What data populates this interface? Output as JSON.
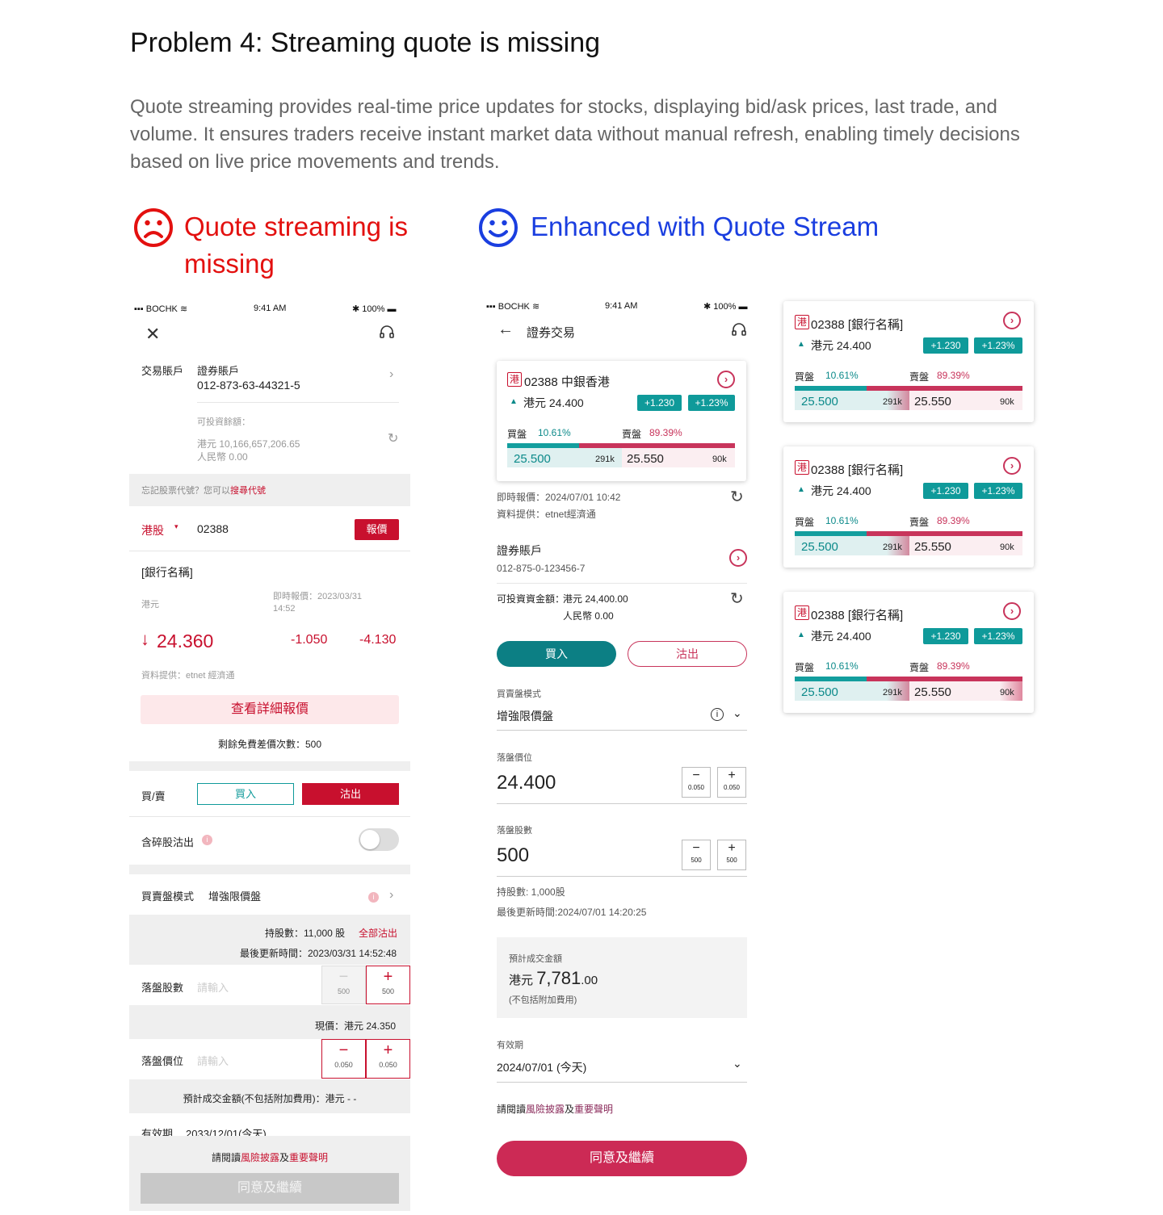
{
  "title": "Problem 4: Streaming quote is missing",
  "description": "Quote streaming provides real-time price updates for stocks, displaying bid/ask prices, last trade, and volume. It ensures traders receive instant market data without manual refresh, enabling timely decisions based on live price movements and trends.",
  "colors": {
    "bad": "#e3100f",
    "good": "#1a3ee0",
    "teal": "#0f9a9a",
    "brand_red": "#c8102e"
  },
  "bad": {
    "heading": "Quote streaming is missing",
    "status": {
      "carrier": "BOCHK",
      "time": "9:41 AM",
      "battery": "100%"
    },
    "account_label": "交易賬戶",
    "account_type": "證券賬戶",
    "account_no": "012-873-63-44321-5",
    "funds_label": "可投資餘額：",
    "funds_hkd": "港元 10,166,657,206.65",
    "funds_rmb": "人民幣 0.00",
    "forgot_text": "忘記股票代號？您可以",
    "forgot_link": "搜尋代號",
    "market": "港股",
    "code": "02388",
    "quote_btn": "報價",
    "name": "[銀行名稱]",
    "currency": "港元",
    "quote_time": "即時報價：2023/03/31 14:52",
    "price": "24.360",
    "change": "-1.050",
    "change_pct": "-4.130",
    "source": "資料提供：etnet 經濟通",
    "detail_btn": "查看詳細報價",
    "remain": "剩餘免費差價次數：500",
    "side_label": "買/賣",
    "buy": "買入",
    "sell": "沽出",
    "odd_lot": "含碎股沽出",
    "mode_label": "買賣盤模式",
    "mode_value": "增強限價盤",
    "holding": "持股數：11,000 股",
    "sell_all": "全部沽出",
    "updated": "最後更新時間：2023/03/31 14:52:48",
    "qty_label": "落盤股數",
    "placeholder": "請輸入",
    "qty_step": "500",
    "current": "現價：港元 24.350",
    "price_label": "落盤價位",
    "price_step": "0.050",
    "est": "預計成交金額(不包括附加費用)：港元 - -",
    "expiry_label": "有效期",
    "expiry_value": "2033/12/01(今天)",
    "read_pre": "請閱讀",
    "risk": "風險披露",
    "read_and": "及",
    "notice": "重要聲明",
    "continue": "同意及繼續"
  },
  "good": {
    "heading": "Enhanced with Quote Stream",
    "status": {
      "carrier": "BOCHK",
      "time": "9:41 AM",
      "battery": "100%"
    },
    "nav_title": "證券交易",
    "market_tag": "港",
    "card": {
      "code": "02388",
      "name": "中銀香港",
      "price": "港元 24.400",
      "chg": "+1.230",
      "pct": "+1.23%",
      "bid_label": "買盤",
      "bid_pct": "10.61%",
      "ask_label": "賣盤",
      "ask_pct": "89.39%",
      "bid": "25.500",
      "bid_vol": "291k",
      "ask": "25.550",
      "ask_vol": "90k"
    },
    "quote_time": "即時報價：2024/07/01 10:42",
    "source": "資料提供：etnet經濟通",
    "account_type": "證券賬戶",
    "account_no": "012-875-0-123456-7",
    "funds_label": "可投資資金額：",
    "funds_hkd": "港元 24,400.00",
    "funds_rmb": "人民幣 0.00",
    "buy": "買入",
    "sell": "沽出",
    "mode_label": "買賣盤模式",
    "mode_value": "增強限價盤",
    "price_label": "落盤價位",
    "price": "24.400",
    "price_step": "0.050",
    "qty_label": "落盤股數",
    "qty": "500",
    "qty_step": "500",
    "holding": "持股數: 1,000股",
    "updated": "最後更新時間:2024/07/01 14:20:25",
    "est_label": "預計成交金額",
    "est_cur": "港元",
    "est_int": "7,781",
    "est_dec": ".00",
    "est_note": "(不包括附加費用)",
    "expiry_label": "有效期",
    "expiry_value": "2024/07/01 (今天)",
    "read_pre": "請閱讀",
    "risk": "風險披露",
    "read_and": "及",
    "notice": "重要聲明",
    "continue": "同意及繼續"
  },
  "variants": [
    {
      "code": "02388",
      "name": "[銀行名稱]",
      "price": "港元 24.400",
      "chg": "+1.230",
      "pct": "+1.23%",
      "bid_label": "買盤",
      "bid_pct": "10.61%",
      "ask_label": "賣盤",
      "ask_pct": "89.39%",
      "bid": "25.500",
      "bid_vol": "291k",
      "ask": "25.550",
      "ask_vol": "90k"
    },
    {
      "code": "02388",
      "name": "[銀行名稱]",
      "price": "港元 24.400",
      "chg": "+1.230",
      "pct": "+1.23%",
      "bid_label": "買盤",
      "bid_pct": "10.61%",
      "ask_label": "賣盤",
      "ask_pct": "89.39%",
      "bid": "25.500",
      "bid_vol": "291k",
      "ask": "25.550",
      "ask_vol": "90k"
    },
    {
      "code": "02388",
      "name": "[銀行名稱]",
      "price": "港元 24.400",
      "chg": "+1.230",
      "pct": "+1.23%",
      "bid_label": "買盤",
      "bid_pct": "10.61%",
      "ask_label": "賣盤",
      "ask_pct": "89.39%",
      "bid": "25.500",
      "bid_vol": "291k",
      "ask": "25.550",
      "ask_vol": "90k"
    }
  ]
}
